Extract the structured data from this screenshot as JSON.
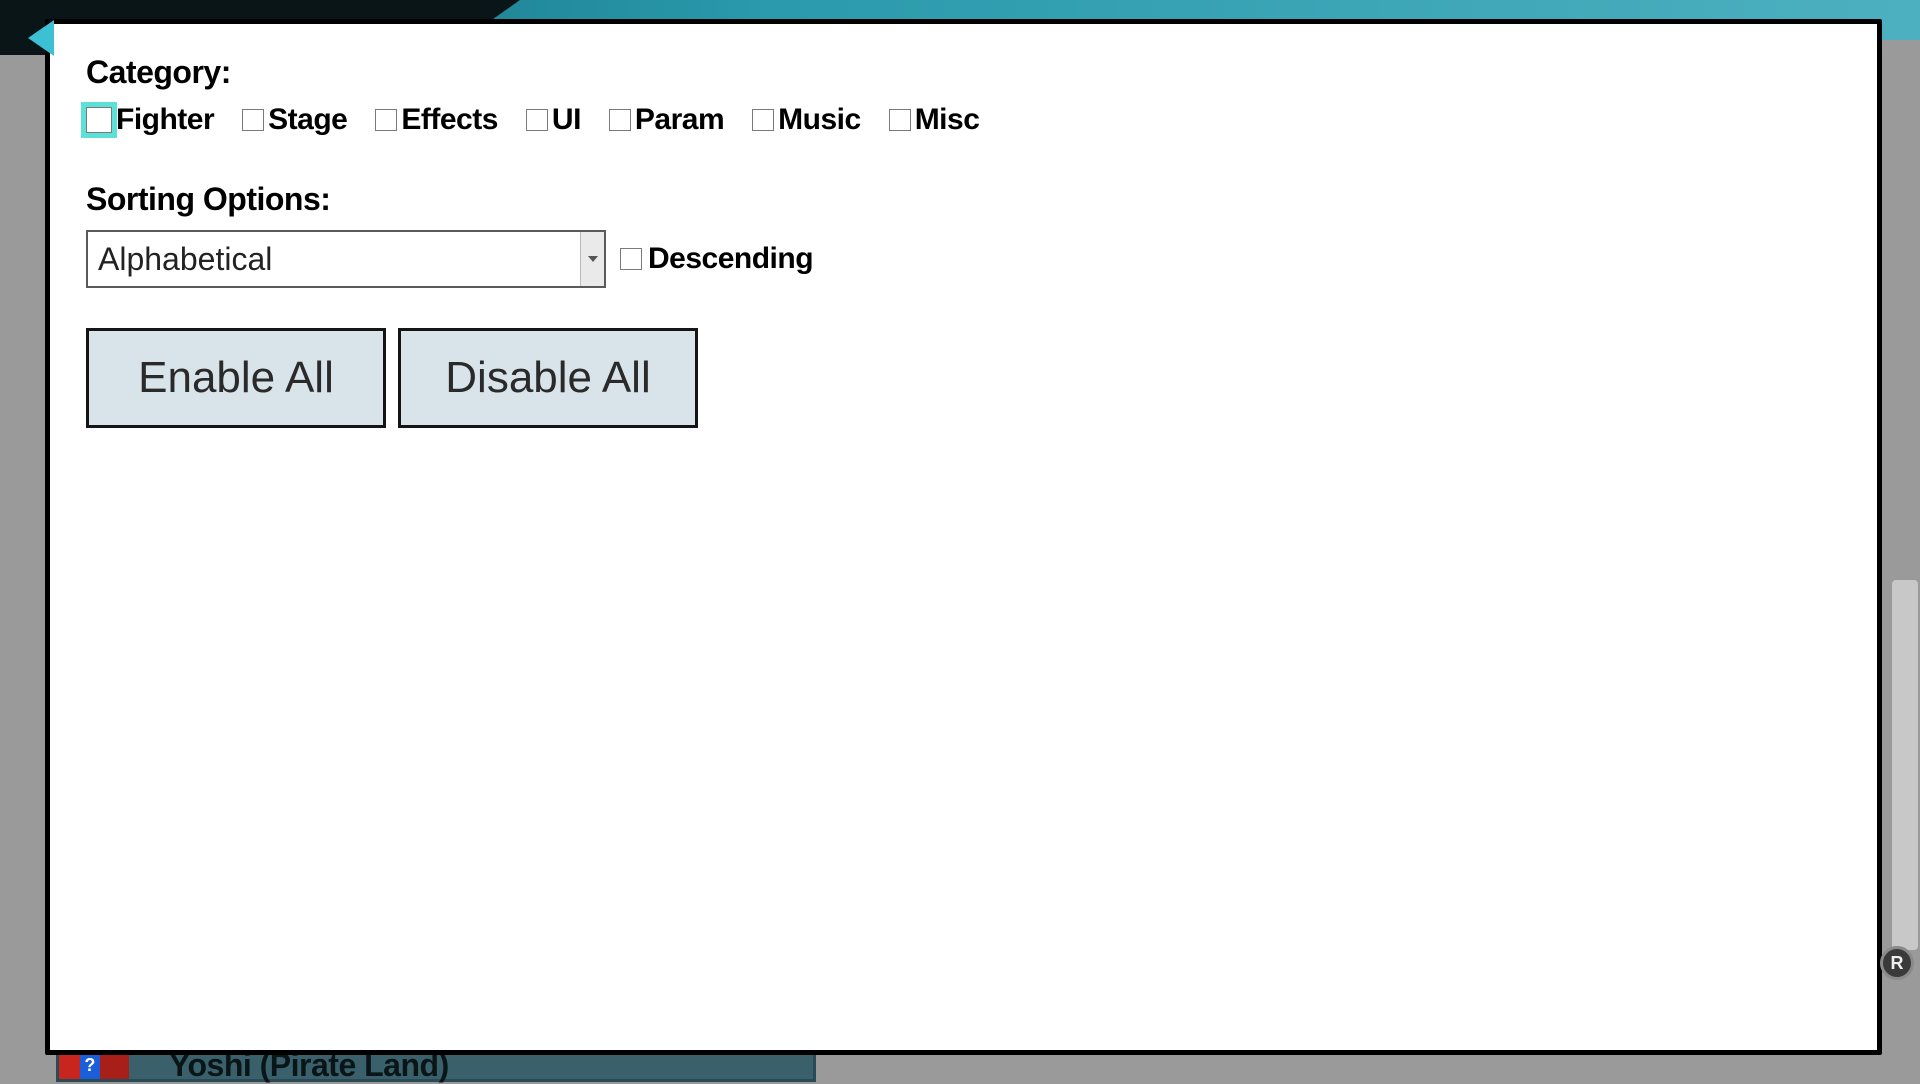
{
  "category": {
    "label": "Category:",
    "items": [
      {
        "label": "Fighter",
        "highlighted": true
      },
      {
        "label": "Stage",
        "highlighted": false
      },
      {
        "label": "Effects",
        "highlighted": false
      },
      {
        "label": "UI",
        "highlighted": false
      },
      {
        "label": "Param",
        "highlighted": false
      },
      {
        "label": "Music",
        "highlighted": false
      },
      {
        "label": "Misc",
        "highlighted": false
      }
    ]
  },
  "sorting": {
    "label": "Sorting Options:",
    "selected": "Alphabetical",
    "descending_label": "Descending"
  },
  "buttons": {
    "enable_all": "Enable All",
    "disable_all": "Disable All"
  },
  "bottom_item": {
    "icon_char": "?",
    "label": "Yoshi (Pirate Land)"
  },
  "r_badge": "R"
}
